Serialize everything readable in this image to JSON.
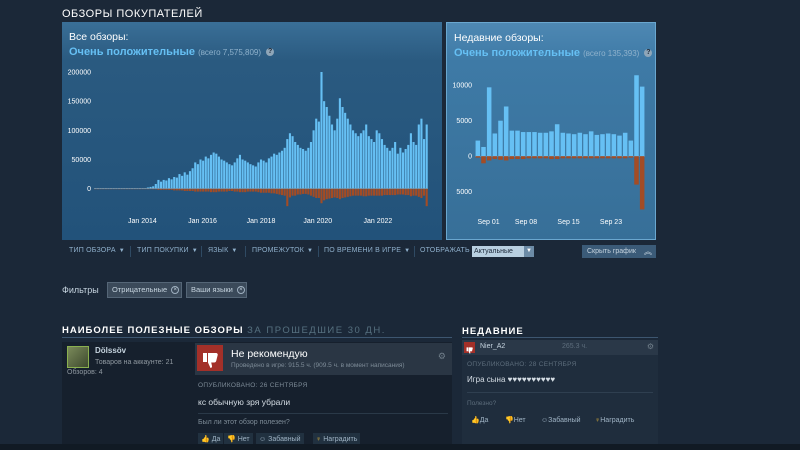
{
  "section_title": "ОБЗОРЫ ПОКУПАТЕЛЕЙ",
  "all_reviews": {
    "label": "Все обзоры:",
    "rating": "Очень положительные",
    "total": "(всего 7,575,809)",
    "help_icon": "question-icon"
  },
  "recent_reviews": {
    "label": "Недавние обзоры:",
    "rating": "Очень положительные",
    "total": "(всего 135,393)",
    "help_icon": "question-icon"
  },
  "chart_data": [
    {
      "type": "bar",
      "x_tick_labels": [
        "Jan 2014",
        "Jan 2016",
        "Jan 2018",
        "Jan 2020",
        "Jan 2022"
      ],
      "y_tick_labels": [
        "200000",
        "150000",
        "100000",
        "50000",
        "0"
      ],
      "ylim": [
        -40000,
        200000
      ],
      "series": [
        {
          "color": "#66c0f4",
          "values": [
            1000,
            1000,
            1000,
            1000,
            1000,
            1000,
            1000,
            1000,
            1000,
            1000,
            1000,
            1000,
            1000,
            1000,
            1000,
            1000,
            1000,
            1000,
            1000,
            1000,
            2000,
            3000,
            4000,
            8000,
            15000,
            12000,
            15000,
            14000,
            18000,
            16000,
            20000,
            19000,
            25000,
            22000,
            28000,
            24000,
            30000,
            35000,
            45000,
            42000,
            50000,
            48000,
            55000,
            52000,
            58000,
            62000,
            60000,
            55000,
            50000,
            48000,
            45000,
            42000,
            40000,
            45000,
            52000,
            58000,
            50000,
            48000,
            45000,
            42000,
            40000,
            38000,
            45000,
            50000,
            48000,
            45000,
            52000,
            55000,
            60000,
            58000,
            62000,
            65000,
            70000,
            85000,
            95000,
            90000,
            80000,
            75000,
            70000,
            68000,
            65000,
            70000,
            80000,
            100000,
            120000,
            115000,
            200000,
            150000,
            140000,
            125000,
            110000,
            100000,
            120000,
            155000,
            140000,
            130000,
            120000,
            110000,
            100000,
            95000,
            90000,
            95000,
            100000,
            110000,
            90000,
            85000,
            80000,
            100000,
            95000,
            85000,
            75000,
            70000,
            65000,
            70000,
            80000,
            60000,
            70000,
            62000,
            68000,
            75000,
            95000,
            80000,
            75000,
            110000,
            120000,
            85000,
            110000
          ]
        },
        {
          "color": "#a34c25",
          "values": [
            0,
            0,
            0,
            0,
            0,
            0,
            0,
            0,
            0,
            0,
            0,
            0,
            0,
            0,
            0,
            0,
            0,
            0,
            0,
            0,
            0,
            0,
            -1000,
            -1000,
            -2000,
            -2000,
            -2000,
            -2000,
            -2000,
            -2000,
            -3000,
            -3000,
            -3000,
            -3000,
            -4000,
            -4000,
            -4000,
            -4000,
            -5000,
            -5000,
            -5000,
            -5000,
            -5000,
            -5000,
            -6000,
            -6000,
            -6000,
            -5000,
            -5000,
            -5000,
            -5000,
            -4000,
            -4000,
            -5000,
            -5000,
            -6000,
            -6000,
            -6000,
            -5000,
            -5000,
            -5000,
            -5000,
            -6000,
            -7000,
            -7000,
            -7000,
            -7000,
            -8000,
            -8000,
            -9000,
            -10000,
            -11000,
            -12000,
            -30000,
            -15000,
            -12000,
            -12000,
            -10000,
            -10000,
            -9000,
            -9000,
            -10000,
            -12000,
            -14000,
            -16000,
            -16000,
            -25000,
            -20000,
            -18000,
            -17000,
            -16000,
            -15000,
            -16000,
            -18000,
            -16000,
            -15000,
            -14000,
            -13000,
            -12000,
            -12000,
            -12000,
            -12000,
            -13000,
            -13000,
            -12000,
            -12000,
            -12000,
            -12000,
            -12000,
            -12000,
            -11000,
            -11000,
            -11000,
            -11000,
            -11000,
            -10000,
            -10000,
            -10000,
            -11000,
            -11000,
            -13000,
            -12000,
            -12000,
            -14000,
            -16000,
            -12000,
            -30000
          ]
        }
      ]
    },
    {
      "type": "bar",
      "x_tick_labels": [
        "Sep 01",
        "Sep 08",
        "Sep 15",
        "Sep 23"
      ],
      "y_tick_labels": [
        "10000",
        "5000",
        "0",
        "5000"
      ],
      "ylim": [
        -8000,
        12000
      ],
      "series": [
        {
          "color": "#66c0f4",
          "values": [
            2200,
            1300,
            9700,
            3200,
            5000,
            7000,
            3600,
            3600,
            3400,
            3400,
            3400,
            3300,
            3300,
            3500,
            4500,
            3300,
            3200,
            3100,
            3300,
            3100,
            3500,
            3000,
            3100,
            3200,
            3100,
            2900,
            3300,
            2200,
            11400,
            9800
          ]
        },
        {
          "color": "#a34c25",
          "values": [
            -200,
            -1000,
            -600,
            -400,
            -500,
            -600,
            -400,
            -400,
            -400,
            -300,
            -300,
            -300,
            -300,
            -400,
            -400,
            -300,
            -300,
            -300,
            -300,
            -300,
            -300,
            -300,
            -300,
            -300,
            -300,
            -300,
            -300,
            -200,
            -4000,
            -7500
          ]
        }
      ]
    }
  ],
  "filter_bar": {
    "review_type": "ТИП ОБЗОРА",
    "purchase_type": "ТИП ПОКУПКИ",
    "language": "ЯЗЫК",
    "period": "ПРОМЕЖУТОК",
    "playtime": "ПО ВРЕМЕНИ В ИГРЕ",
    "display_label": "ОТОБРАЖАТЬ",
    "display_value": "Актуальные",
    "collapse": "Скрыть график"
  },
  "filters": {
    "label": "Фильтры",
    "chips": [
      "Отрицательные",
      "Ваши языки"
    ]
  },
  "helpful_section": {
    "title": "НАИБОЛЕЕ ПОЛЕЗНЫЕ ОБЗОРЫ",
    "subtitle": "ЗА ПРОШЕДШИЕ 30 ДН."
  },
  "recent_section": {
    "title": "НЕДАВНИЕ"
  },
  "review": {
    "author": "Dölssöv",
    "games": "Товаров на аккаунте: 21",
    "reviews": "Обзоров: 4",
    "verdict": "Не рекомендую",
    "hours": "Проведено в игре: 915.5 ч. (909.5 ч. в момент написания)",
    "posted": "ОПУБЛИКОВАНО: 26 СЕНТЯБРЯ",
    "text": "кс обычную зря убрали",
    "helpful_question": "Был ли этот обзор полезен?",
    "buttons": {
      "yes": "Да",
      "no": "Нет",
      "funny": "Забавный",
      "award": "Наградить"
    }
  },
  "recent_review": {
    "author": "Nier_A2",
    "hours": "265.3 ч.",
    "posted": "ОПУБЛИКОВАНО: 28 СЕНТЯБРЯ",
    "text": "Игра сына ♥♥♥♥♥♥♥♥♥♥",
    "helpful_question": "Полезно?",
    "buttons": {
      "yes": "Да",
      "no": "Нет",
      "funny": "Забавный",
      "award": "Наградить"
    }
  }
}
